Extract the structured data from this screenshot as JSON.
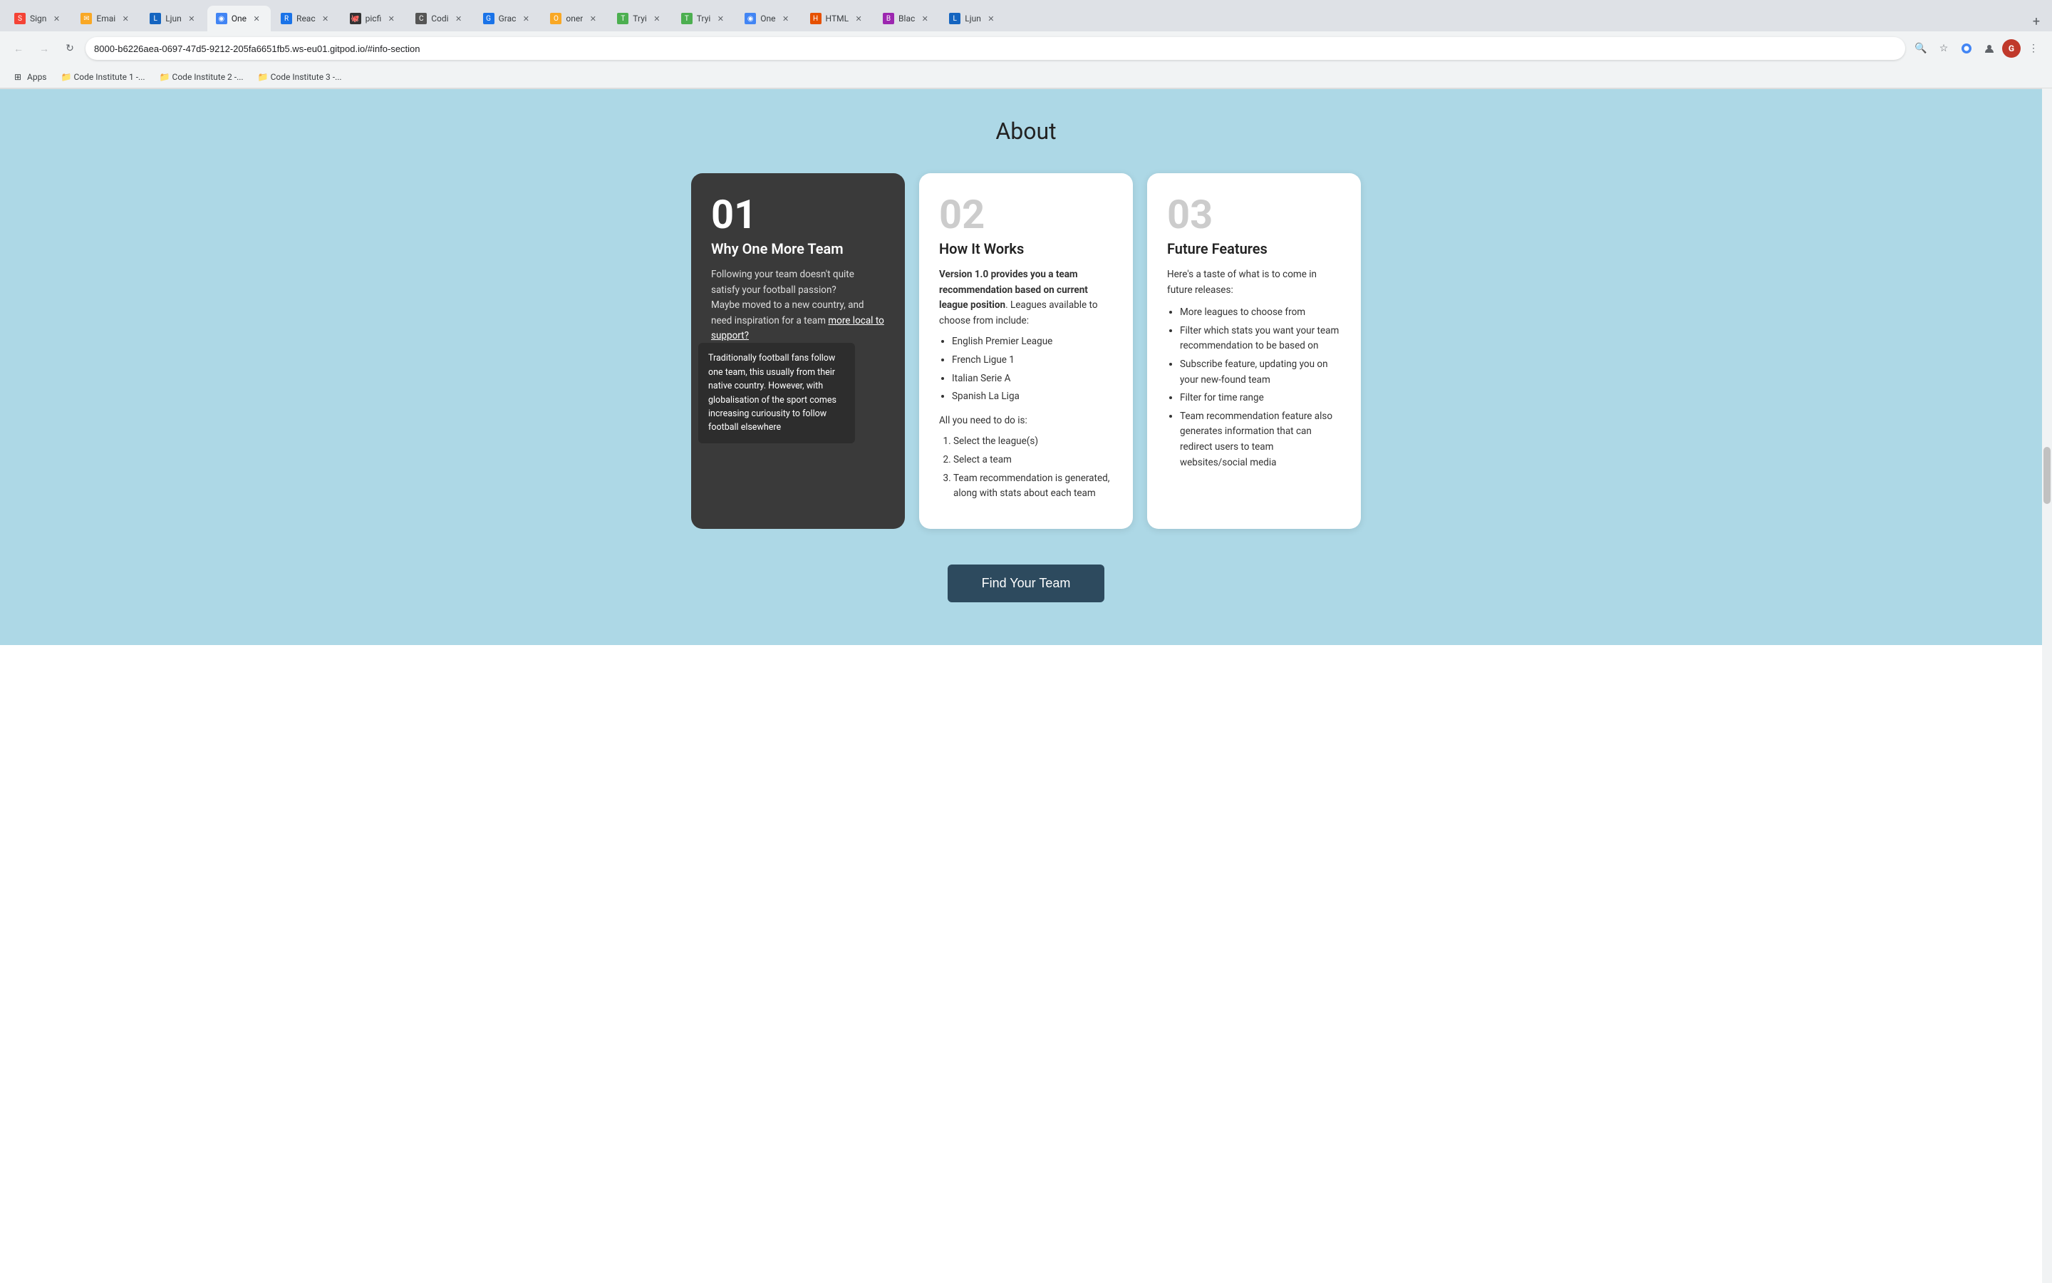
{
  "browser": {
    "url": "8000-b6226aea-0697-47d5-9212-205fa6651fb5.ws-eu01.gitpod.io/#info-section",
    "tabs": [
      {
        "id": "sign",
        "favicon_color": "#f44336",
        "favicon_text": "S",
        "label": "Sign",
        "active": false
      },
      {
        "id": "email",
        "favicon_color": "#f9a825",
        "favicon_text": "✉",
        "label": "Emai",
        "active": false
      },
      {
        "id": "ljun1",
        "favicon_color": "#1565c0",
        "favicon_text": "L",
        "label": "Ljun",
        "active": false
      },
      {
        "id": "one",
        "favicon_color": "#4285f4",
        "favicon_text": "◉",
        "label": "One",
        "active": true
      },
      {
        "id": "read",
        "favicon_color": "#1a73e8",
        "favicon_text": "R",
        "label": "Reac",
        "active": false
      },
      {
        "id": "picfl",
        "favicon_color": "#333",
        "favicon_text": "🐙",
        "label": "picfi",
        "active": false
      },
      {
        "id": "code1",
        "favicon_color": "#555",
        "favicon_text": "C",
        "label": "Codi",
        "active": false
      },
      {
        "id": "grad",
        "favicon_color": "#1a73e8",
        "favicon_text": "G",
        "label": "Grac",
        "active": false
      },
      {
        "id": "oner1",
        "favicon_color": "#f9a825",
        "favicon_text": "O",
        "label": "oner",
        "active": false
      },
      {
        "id": "try1",
        "favicon_color": "#4caf50",
        "favicon_text": "T",
        "label": "Tryi",
        "active": false
      },
      {
        "id": "try2",
        "favicon_color": "#4caf50",
        "favicon_text": "T",
        "label": "Tryi",
        "active": false
      },
      {
        "id": "one2",
        "favicon_color": "#4285f4",
        "favicon_text": "◉",
        "label": "One",
        "active": false
      },
      {
        "id": "html",
        "favicon_color": "#e65100",
        "favicon_text": "H",
        "label": "HTML",
        "active": false
      },
      {
        "id": "blac",
        "favicon_color": "#9c27b0",
        "favicon_text": "B",
        "label": "Blac",
        "active": false
      },
      {
        "id": "ljun2",
        "favicon_color": "#1565c0",
        "favicon_text": "L",
        "label": "Ljun",
        "active": false
      }
    ],
    "bookmarks": [
      {
        "id": "apps",
        "icon": "⊞",
        "label": "Apps"
      },
      {
        "id": "ci1",
        "icon": "📁",
        "label": "Code Institute 1 -..."
      },
      {
        "id": "ci2",
        "icon": "📁",
        "label": "Code Institute 2 -..."
      },
      {
        "id": "ci3",
        "icon": "📁",
        "label": "Code Institute 3 -..."
      }
    ],
    "avatar_text": "G"
  },
  "page": {
    "title": "About",
    "card1": {
      "number": "01",
      "title": "Why One More Team",
      "body_line1": "Following your team doesn't quite satisfy your football passion?",
      "body_line2": "Maybe moved to a new country, and need inspiration for a team",
      "link_text": "more local to support?",
      "tooltip_text": "Traditionally football fans follow one team, this usually from their native country. However, with globalisation of the sport comes increasing curiousity to follow football elsewhere"
    },
    "card2": {
      "number": "02",
      "title": "How It Works",
      "intro_bold": "Version 1.0 provides you a team recommendation based on current league position",
      "intro_suffix": ". Leagues available to choose from include:",
      "leagues": [
        "English Premier League",
        "French Ligue 1",
        "Italian Serie A",
        "Spanish La Liga"
      ],
      "steps_intro": "All you need to do is:",
      "steps": [
        "Select the league(s)",
        "Select a team",
        "Team recommendation is generated, along with stats about each team"
      ]
    },
    "card3": {
      "number": "03",
      "title": "Future Features",
      "intro": "Here's a taste of what is to come in future releases:",
      "features": [
        "More leagues to choose from",
        "Filter which stats you want your team recommendation to be based on",
        "Subscribe feature, updating you on your new-found team",
        "Filter for time range",
        "Team recommendation feature also generates information that can redirect users to team websites/social media"
      ]
    },
    "cta_button": "Find Your Team"
  }
}
